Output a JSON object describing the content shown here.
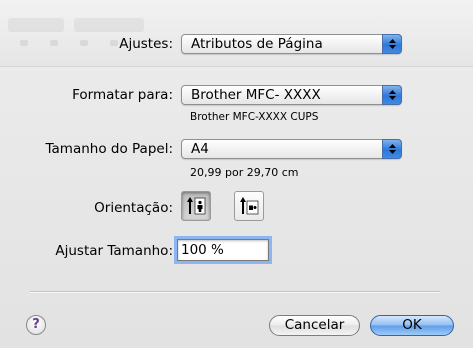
{
  "page_setup": {
    "settings_label": "Ajustes:",
    "settings_value": "Atributos de Página",
    "format_for_label": "Formatar para:",
    "format_for_value": "Brother MFC- XXXX",
    "format_for_sub": "Brother MFC-XXXX CUPS",
    "paper_size_label": "Tamanho do Papel:",
    "paper_size_value": "A4",
    "paper_size_sub": "20,99 por 29,70 cm",
    "orientation_label": "Orientação:",
    "orientation_selected": "portrait",
    "scale_label": "Ajustar Tamanho:",
    "scale_value": "100 %"
  },
  "buttons": {
    "help": "?",
    "cancel": "Cancelar",
    "ok": "OK"
  },
  "colors": {
    "accent": "#3f8ae6",
    "focus_ring": "#8bb6ef"
  }
}
